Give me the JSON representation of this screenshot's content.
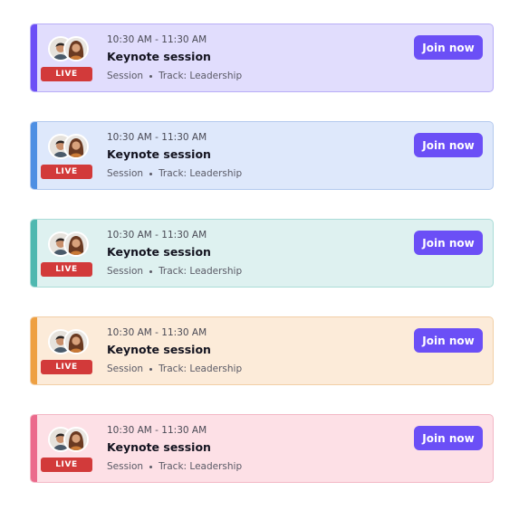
{
  "sessions": [
    {
      "time": "10:30 AM - 11:30 AM",
      "title": "Keynote session",
      "type": "Session",
      "track": "Track: Leadership",
      "badge": "LIVE",
      "button": "Join now",
      "colors": {
        "accent": "#6b4ff6",
        "background": "#e1ddfd",
        "border": "#b8adf7"
      }
    },
    {
      "time": "10:30 AM - 11:30 AM",
      "title": "Keynote session",
      "type": "Session",
      "track": "Track: Leadership",
      "badge": "LIVE",
      "button": "Join now",
      "colors": {
        "accent": "#4e8fe3",
        "background": "#dee8fb",
        "border": "#b3c9ee"
      }
    },
    {
      "time": "10:30 AM - 11:30 AM",
      "title": "Keynote session",
      "type": "Session",
      "track": "Track: Leadership",
      "badge": "LIVE",
      "button": "Join now",
      "colors": {
        "accent": "#4fb8b0",
        "background": "#def1f0",
        "border": "#a9dcd7"
      }
    },
    {
      "time": "10:30 AM - 11:30 AM",
      "title": "Keynote session",
      "type": "Session",
      "track": "Track: Leadership",
      "badge": "LIVE",
      "button": "Join now",
      "colors": {
        "accent": "#eea042",
        "background": "#fcebd9",
        "border": "#f2cfa6"
      }
    },
    {
      "time": "10:30 AM - 11:30 AM",
      "title": "Keynote session",
      "type": "Session",
      "track": "Track: Leadership",
      "badge": "LIVE",
      "button": "Join now",
      "colors": {
        "accent": "#eb6a8c",
        "background": "#fde0e6",
        "border": "#f3b7c5"
      }
    }
  ],
  "avatar_icons": [
    "avatar-man-icon",
    "avatar-woman-icon"
  ],
  "badge_color": "#d23a3a",
  "button_color": "#6b4ff6"
}
